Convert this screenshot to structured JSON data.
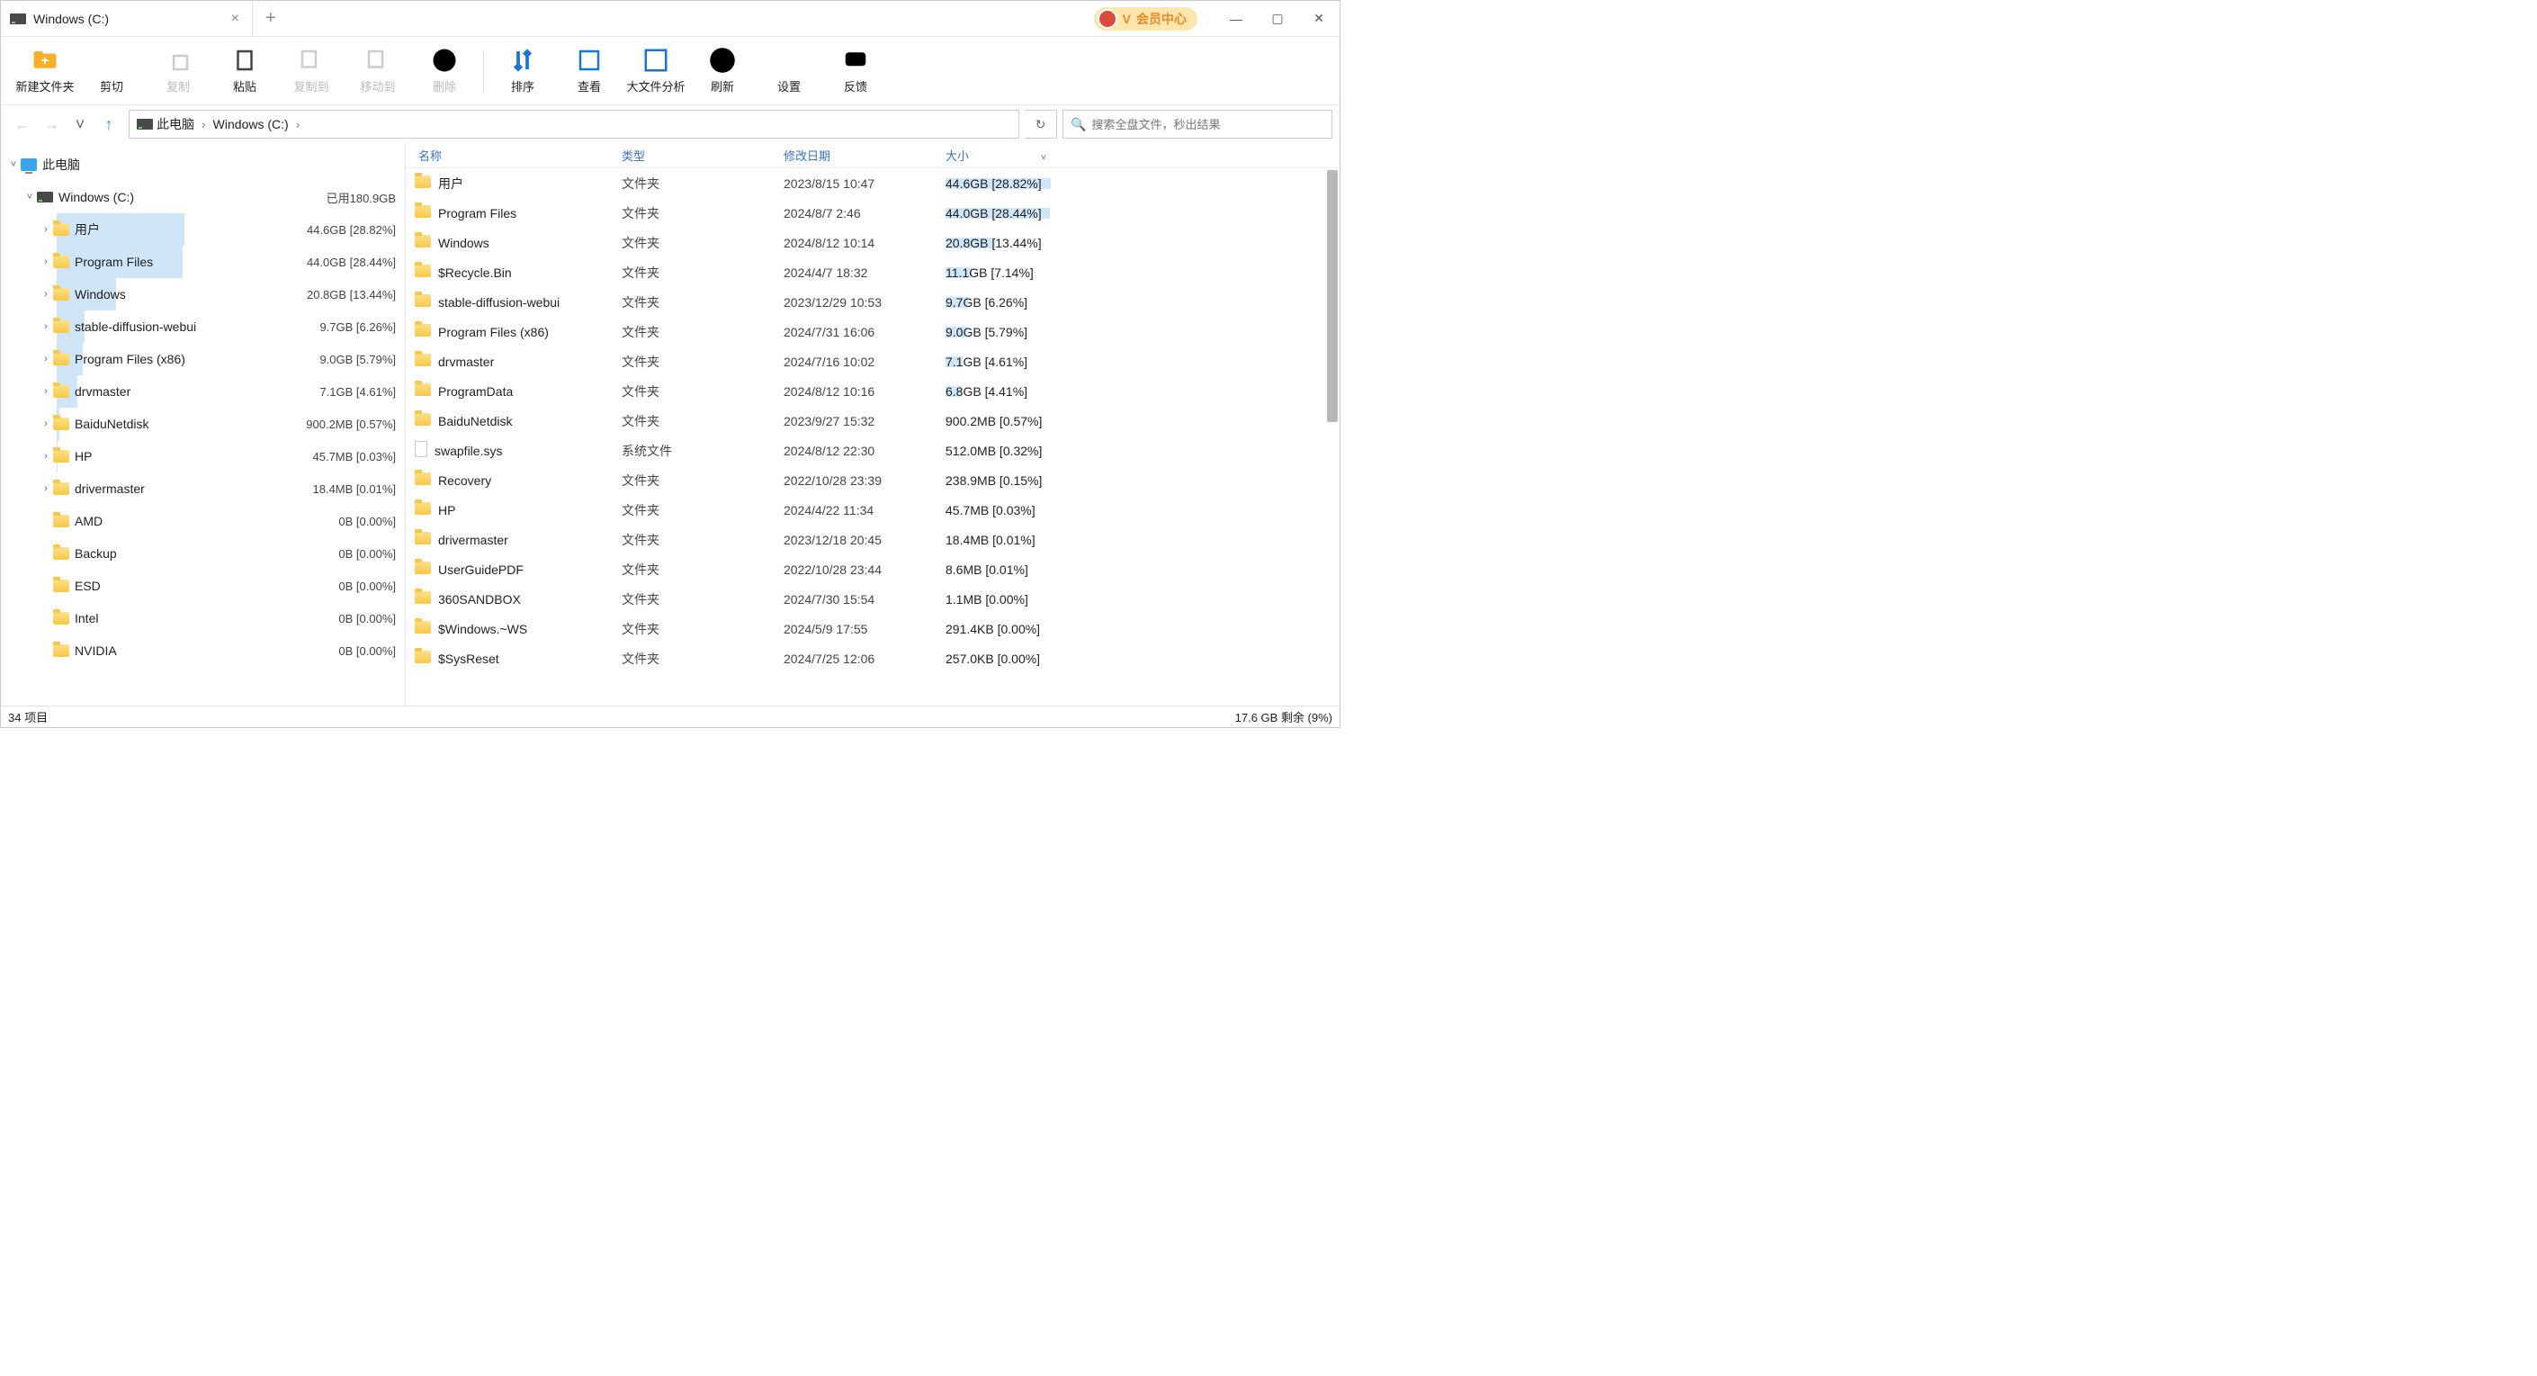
{
  "titlebar": {
    "tab_title": "Windows (C:)"
  },
  "vip": {
    "label": "会员中心",
    "v": "V"
  },
  "toolbar": [
    {
      "id": "new-folder",
      "label": "新建文件夹",
      "enabled": true,
      "icon": "folder-plus",
      "color": "#f9b028"
    },
    {
      "id": "cut",
      "label": "剪切",
      "enabled": true,
      "icon": "scissors",
      "color": "#444"
    },
    {
      "id": "copy",
      "label": "复制",
      "enabled": false,
      "icon": "copy",
      "color": "#ccc"
    },
    {
      "id": "paste",
      "label": "粘贴",
      "enabled": true,
      "icon": "paste",
      "color": "#2a8"
    },
    {
      "id": "copy-to",
      "label": "复制到",
      "enabled": false,
      "icon": "copyto",
      "color": "#ccc"
    },
    {
      "id": "move-to",
      "label": "移动到",
      "enabled": false,
      "icon": "moveto",
      "color": "#ccc"
    },
    {
      "id": "delete",
      "label": "删除",
      "enabled": false,
      "icon": "delete",
      "color": "#ccc"
    },
    {
      "id": "sep",
      "sep": true
    },
    {
      "id": "sort",
      "label": "排序",
      "enabled": true,
      "icon": "sort",
      "color": "#1976d2"
    },
    {
      "id": "view",
      "label": "查看",
      "enabled": true,
      "icon": "view",
      "color": "#1976d2"
    },
    {
      "id": "big-file",
      "label": "大文件分析",
      "enabled": true,
      "icon": "chart",
      "color": "#1976d2"
    },
    {
      "id": "refresh",
      "label": "刷新",
      "enabled": true,
      "icon": "refresh",
      "color": "#3fb552"
    },
    {
      "id": "settings",
      "label": "设置",
      "enabled": true,
      "icon": "gear",
      "color": "#444"
    },
    {
      "id": "feedback",
      "label": "反馈",
      "enabled": true,
      "icon": "chat",
      "color": "#1e88e5"
    }
  ],
  "breadcrumb": {
    "root": "此电脑",
    "items": [
      "Windows (C:)"
    ]
  },
  "search": {
    "placeholder": "搜索全盘文件，秒出结果"
  },
  "tree": {
    "root": {
      "label": "此电脑",
      "expanded": true
    },
    "drive": {
      "label": "Windows (C:)",
      "usage": "已用180.9GB",
      "expanded": true
    },
    "items": [
      {
        "name": "用户",
        "size": "44.6GB [28.82%]",
        "exp": true,
        "bar": 28.82
      },
      {
        "name": "Program Files",
        "size": "44.0GB [28.44%]",
        "exp": true,
        "bar": 28.44
      },
      {
        "name": "Windows",
        "size": "20.8GB [13.44%]",
        "exp": true,
        "bar": 13.44
      },
      {
        "name": "stable-diffusion-webui",
        "size": "9.7GB [6.26%]",
        "exp": true,
        "bar": 6.26
      },
      {
        "name": "Program Files (x86)",
        "size": "9.0GB [5.79%]",
        "exp": true,
        "bar": 5.79
      },
      {
        "name": "drvmaster",
        "size": "7.1GB [4.61%]",
        "exp": true,
        "bar": 4.61
      },
      {
        "name": "BaiduNetdisk",
        "size": "900.2MB [0.57%]",
        "exp": true,
        "bar": 0.57
      },
      {
        "name": "HP",
        "size": "45.7MB [0.03%]",
        "exp": true,
        "bar": 0.03
      },
      {
        "name": "drivermaster",
        "size": "18.4MB [0.01%]",
        "exp": true,
        "bar": 0.01
      },
      {
        "name": "AMD",
        "size": "0B [0.00%]",
        "exp": false,
        "bar": 0
      },
      {
        "name": "Backup",
        "size": "0B [0.00%]",
        "exp": false,
        "bar": 0
      },
      {
        "name": "ESD",
        "size": "0B [0.00%]",
        "exp": false,
        "bar": 0
      },
      {
        "name": "Intel",
        "size": "0B [0.00%]",
        "exp": false,
        "bar": 0
      },
      {
        "name": "NVIDIA",
        "size": "0B [0.00%]",
        "exp": false,
        "bar": 0
      }
    ]
  },
  "columns": {
    "name": "名称",
    "type": "类型",
    "date": "修改日期",
    "size": "大小"
  },
  "files": [
    {
      "name": "用户",
      "type": "文件夹",
      "date": "2023/8/15 10:47",
      "size": "44.6GB [28.82%]",
      "bar": 28.82,
      "icon": "folder"
    },
    {
      "name": "Program Files",
      "type": "文件夹",
      "date": "2024/8/7 2:46",
      "size": "44.0GB [28.44%]",
      "bar": 28.44,
      "icon": "folder"
    },
    {
      "name": "Windows",
      "type": "文件夹",
      "date": "2024/8/12 10:14",
      "size": "20.8GB [13.44%]",
      "bar": 13.44,
      "icon": "folder"
    },
    {
      "name": "$Recycle.Bin",
      "type": "文件夹",
      "date": "2024/4/7 18:32",
      "size": "11.1GB [7.14%]",
      "bar": 7.14,
      "icon": "folder"
    },
    {
      "name": "stable-diffusion-webui",
      "type": "文件夹",
      "date": "2023/12/29 10:53",
      "size": "9.7GB [6.26%]",
      "bar": 6.26,
      "icon": "folder"
    },
    {
      "name": "Program Files (x86)",
      "type": "文件夹",
      "date": "2024/7/31 16:06",
      "size": "9.0GB [5.79%]",
      "bar": 5.79,
      "icon": "folder"
    },
    {
      "name": "drvmaster",
      "type": "文件夹",
      "date": "2024/7/16 10:02",
      "size": "7.1GB [4.61%]",
      "bar": 4.61,
      "icon": "folder"
    },
    {
      "name": "ProgramData",
      "type": "文件夹",
      "date": "2024/8/12 10:16",
      "size": "6.8GB [4.41%]",
      "bar": 4.41,
      "icon": "folder"
    },
    {
      "name": "BaiduNetdisk",
      "type": "文件夹",
      "date": "2023/9/27 15:32",
      "size": "900.2MB [0.57%]",
      "bar": 0.57,
      "icon": "folder"
    },
    {
      "name": "swapfile.sys",
      "type": "系统文件",
      "date": "2024/8/12 22:30",
      "size": "512.0MB [0.32%]",
      "bar": 0.32,
      "icon": "file"
    },
    {
      "name": "Recovery",
      "type": "文件夹",
      "date": "2022/10/28 23:39",
      "size": "238.9MB [0.15%]",
      "bar": 0.15,
      "icon": "folder"
    },
    {
      "name": "HP",
      "type": "文件夹",
      "date": "2024/4/22 11:34",
      "size": "45.7MB [0.03%]",
      "bar": 0.03,
      "icon": "folder"
    },
    {
      "name": "drivermaster",
      "type": "文件夹",
      "date": "2023/12/18 20:45",
      "size": "18.4MB [0.01%]",
      "bar": 0.01,
      "icon": "folder"
    },
    {
      "name": "UserGuidePDF",
      "type": "文件夹",
      "date": "2022/10/28 23:44",
      "size": "8.6MB [0.01%]",
      "bar": 0.01,
      "icon": "folder"
    },
    {
      "name": "360SANDBOX",
      "type": "文件夹",
      "date": "2024/7/30 15:54",
      "size": "1.1MB [0.00%]",
      "bar": 0,
      "icon": "folder"
    },
    {
      "name": "$Windows.~WS",
      "type": "文件夹",
      "date": "2024/5/9 17:55",
      "size": "291.4KB [0.00%]",
      "bar": 0,
      "icon": "folder"
    },
    {
      "name": "$SysReset",
      "type": "文件夹",
      "date": "2024/7/25 12:06",
      "size": "257.0KB [0.00%]",
      "bar": 0,
      "icon": "folder"
    }
  ],
  "status": {
    "left": "34 项目",
    "right": "17.6 GB 剩余 (9%)"
  }
}
